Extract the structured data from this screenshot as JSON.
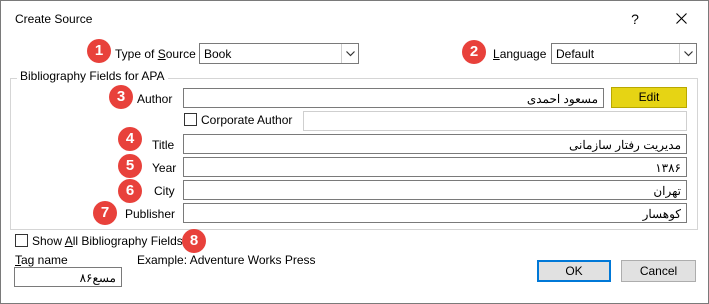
{
  "window": {
    "title": "Create Source",
    "help_label": "?"
  },
  "source_type": {
    "label_pre": "Type of ",
    "label_ul": "S",
    "label_post": "ource",
    "value": "Book"
  },
  "language": {
    "label_ul": "L",
    "label_post": "anguage",
    "value": "Default"
  },
  "group": {
    "title": "Bibliography Fields for APA"
  },
  "fields": {
    "author_label": "Author",
    "author_value": "مسعود احمدی",
    "edit_label": "Edit",
    "corporate_author_label": "Corporate Author",
    "title_label": "Title",
    "title_value": "مدیریت رفتار سازمانی",
    "year_label": "Year",
    "year_value": "۱۳۸۶",
    "city_label": "City",
    "city_value": "تهران",
    "publisher_label": "Publisher",
    "publisher_value": "کوهسار"
  },
  "show_all": {
    "label_pre": "Show ",
    "label_ul": "A",
    "label_post": "ll Bibliography Fields"
  },
  "tag": {
    "label_ul": "T",
    "label_post": "ag name",
    "value": "مسع۸۶"
  },
  "example": "Example: Adventure Works Press",
  "buttons": {
    "ok": "OK",
    "cancel": "Cancel"
  },
  "badges": [
    "1",
    "2",
    "3",
    "4",
    "5",
    "6",
    "7",
    "8"
  ],
  "colors": {
    "badge": "#e8413b",
    "edit_button": "#e6d414",
    "focus_border": "#0078d7"
  }
}
